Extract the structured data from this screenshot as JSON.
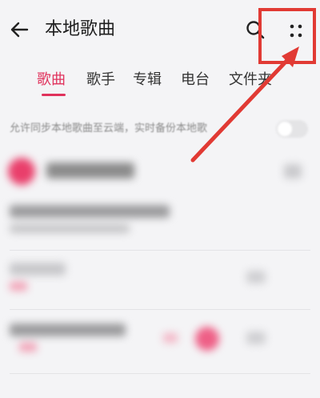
{
  "header": {
    "back_icon": "back-arrow-icon",
    "title": "本地歌曲",
    "search_icon": "search-icon",
    "more_icon": "more-dots-icon"
  },
  "tabs": [
    {
      "label": "歌曲",
      "active": true
    },
    {
      "label": "歌手",
      "active": false
    },
    {
      "label": "专辑",
      "active": false
    },
    {
      "label": "电台",
      "active": false
    },
    {
      "label": "文件夹",
      "active": false
    }
  ],
  "sync": {
    "text": "允许同步本地歌曲至云端，实时备份本地歌"
  },
  "colors": {
    "accent": "#e0325c",
    "annotation": "#e13a34",
    "background": "#f4f4f6"
  }
}
